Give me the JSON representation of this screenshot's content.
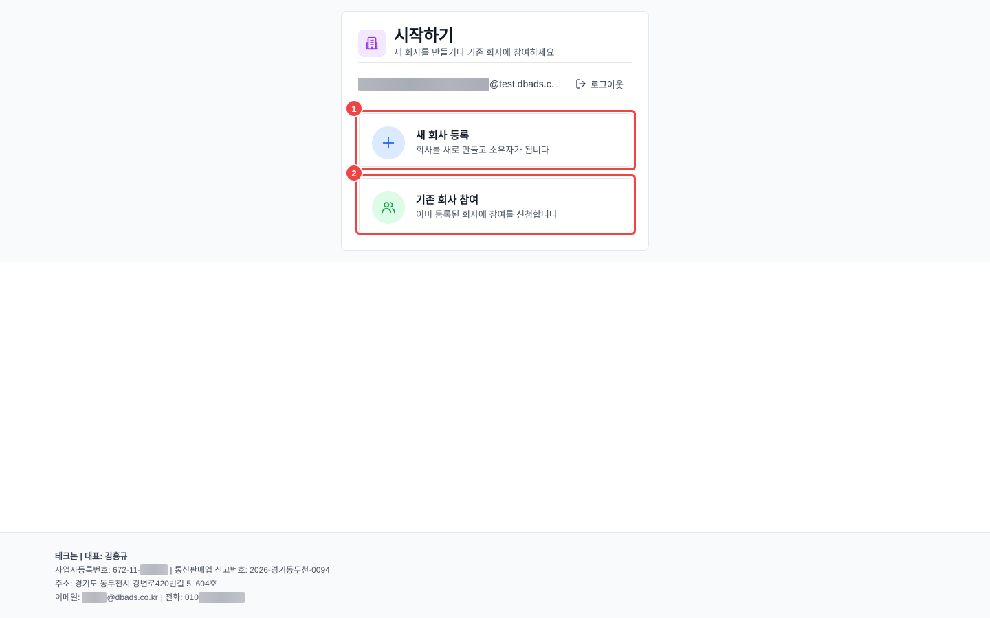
{
  "header": {
    "title": "시작하기",
    "subtitle": "새 회사를 만들거나 기존 회사에 참여하세요",
    "logo_icon": "building-icon"
  },
  "user": {
    "email_suffix": "@test.dbads.c...",
    "logout_label": "로그아웃"
  },
  "options": [
    {
      "badge": "1",
      "title": "새 회사 등록",
      "description": "회사를 새로 만들고 소유자가 됩니다",
      "icon": "plus-icon"
    },
    {
      "badge": "2",
      "title": "기존 회사 참여",
      "description": "이미 등록된 회사에 참여를 신청합니다",
      "icon": "users-icon"
    }
  ],
  "footer": {
    "company_line": "테크논 | 대표: 김홍규",
    "biz_reg_prefix": "사업자등록번호: 672-11-",
    "ecommerce_reg": "| 통신판매업 신고번호: 2026-경기동두천-0094",
    "address": "주소: 경기도 동두천시 강변로420번길 5, 604호",
    "email_prefix": "이메일:",
    "email_suffix": "@dbads.co.kr",
    "phone_prefix": "| 전화: 010"
  },
  "colors": {
    "accent_red": "#ef4444",
    "purple_bg": "#f3e8ff",
    "purple_icon": "#9333ea",
    "blue_bg": "#dbeafe",
    "blue_icon": "#2563eb",
    "green_bg": "#dcfce7",
    "green_icon": "#16a34a"
  }
}
